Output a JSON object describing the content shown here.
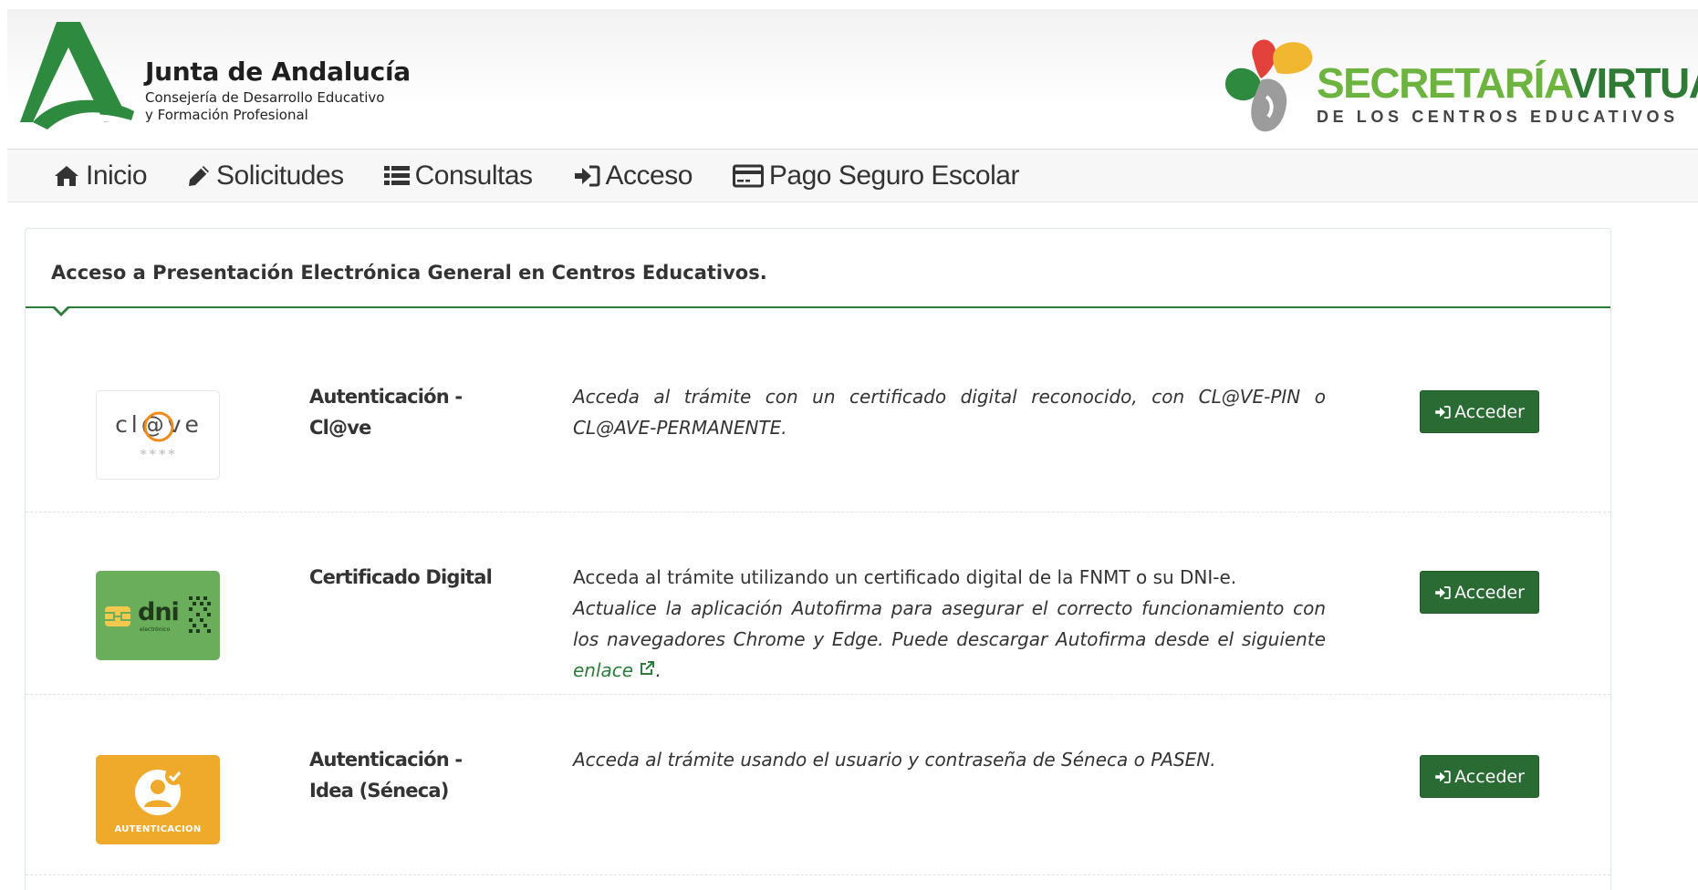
{
  "header": {
    "org_title": "Junta de Andalucía",
    "org_sub1": "Consejería de Desarrollo Educativo",
    "org_sub2": "y Formación Profesional",
    "sv_title_a": "SECRETARÍA",
    "sv_title_b": "VIRTUAL",
    "sv_subtitle": "DE LOS CENTROS EDUCATIVOS"
  },
  "nav": {
    "items": [
      {
        "label": "Inicio",
        "icon": "home-icon"
      },
      {
        "label": "Solicitudes",
        "icon": "pencil-icon"
      },
      {
        "label": "Consultas",
        "icon": "list-icon"
      },
      {
        "label": "Acceso",
        "icon": "sign-in-icon"
      },
      {
        "label": "Pago Seguro Escolar",
        "icon": "credit-card-icon"
      }
    ]
  },
  "panel": {
    "title": "Acceso a Presentación Electrónica General en Centros Educativos."
  },
  "methods": [
    {
      "name": "Autenticación - Cl@ve",
      "logo_text": "cl@ve",
      "logo_stars": "****",
      "desc_italic": "Acceda al trámite con un certificado digital reconocido, con CL@VE-PIN o CL@AVE-PERMANENTE.",
      "button": "Acceder"
    },
    {
      "name": "Certificado Digital",
      "logo_text": "dni",
      "logo_sub": "electrónico",
      "desc_plain": "Acceda al trámite utilizando un certificado digital de la FNMT o su DNI-e.",
      "desc_italic": "Actualice la aplicación Autofirma para asegurar el correcto funcionamiento con los navegadores Chrome y Edge. Puede descargar Autofirma desde el siguiente",
      "link_text": "enlace",
      "desc_end": ".",
      "button": "Acceder"
    },
    {
      "name": "Autenticación - Idea (Séneca)",
      "logo_text": "AUTENTICACION",
      "desc_italic": "Acceda al trámite usando el usuario y contraseña de Séneca o PASEN.",
      "button": "Acceder"
    }
  ],
  "colors": {
    "primary_green": "#2a6b33",
    "accent_light_green": "#6db33f",
    "dni_green": "#6aad5b",
    "idea_orange": "#efa92b"
  }
}
